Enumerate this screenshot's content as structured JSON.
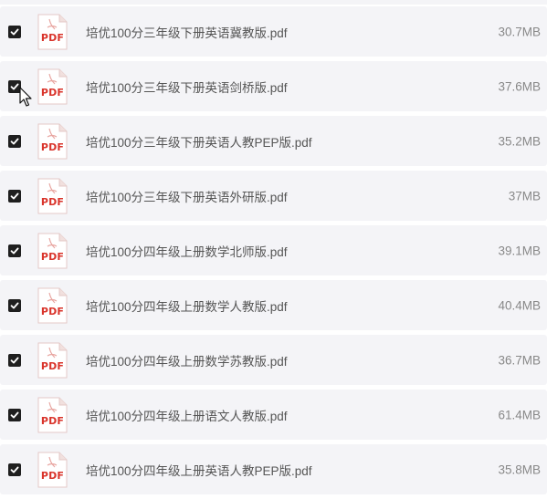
{
  "files": [
    {
      "name": "培优100分三年级下册英语冀教版.pdf",
      "size": "30.7MB",
      "checked": true,
      "icon": "pdf-file-icon",
      "icon_label": "PDF"
    },
    {
      "name": "培优100分三年级下册英语剑桥版.pdf",
      "size": "37.6MB",
      "checked": true,
      "icon": "pdf-file-icon",
      "icon_label": "PDF"
    },
    {
      "name": "培优100分三年级下册英语人教PEP版.pdf",
      "size": "35.2MB",
      "checked": true,
      "icon": "pdf-file-icon",
      "icon_label": "PDF"
    },
    {
      "name": "培优100分三年级下册英语外研版.pdf",
      "size": "37MB",
      "checked": true,
      "icon": "pdf-file-icon",
      "icon_label": "PDF"
    },
    {
      "name": "培优100分四年级上册数学北师版.pdf",
      "size": "39.1MB",
      "checked": true,
      "icon": "pdf-file-icon",
      "icon_label": "PDF"
    },
    {
      "name": "培优100分四年级上册数学人教版.pdf",
      "size": "40.4MB",
      "checked": true,
      "icon": "pdf-file-icon",
      "icon_label": "PDF"
    },
    {
      "name": "培优100分四年级上册数学苏教版.pdf",
      "size": "36.7MB",
      "checked": true,
      "icon": "pdf-file-icon",
      "icon_label": "PDF"
    },
    {
      "name": "培优100分四年级上册语文人教版.pdf",
      "size": "61.4MB",
      "checked": true,
      "icon": "pdf-file-icon",
      "icon_label": "PDF"
    },
    {
      "name": "培优100分四年级上册英语人教PEP版.pdf",
      "size": "35.8MB",
      "checked": true,
      "icon": "pdf-file-icon",
      "icon_label": "PDF"
    }
  ],
  "colors": {
    "row_background": "#f4f4f7",
    "checkbox": "#1f1f1f",
    "pdf_red": "#d9342b",
    "filename_text": "#555555",
    "size_text": "#888888"
  },
  "cursor": "arrow-pointer"
}
